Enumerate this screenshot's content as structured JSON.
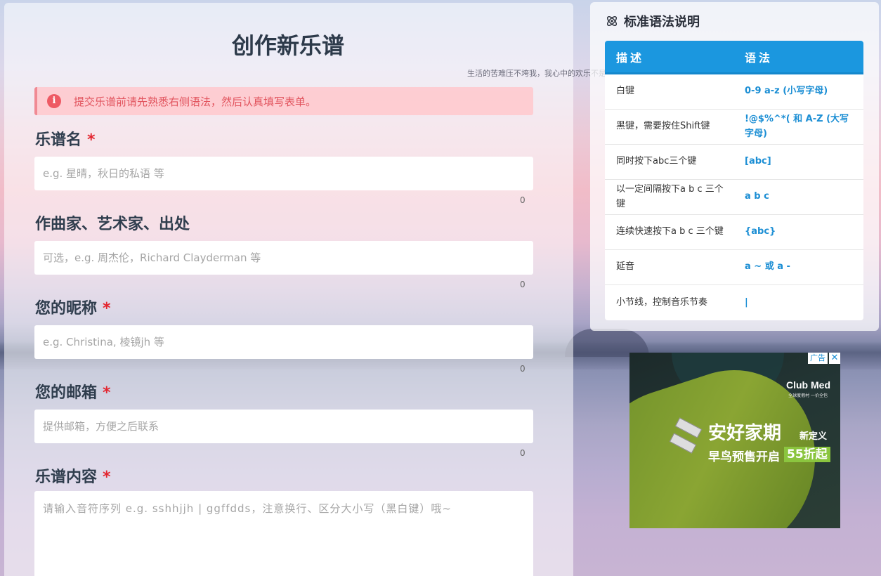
{
  "form": {
    "title": "创作新乐谱",
    "quote": "生活的苦难压不垮我，我心中的欢乐不是我个人的，我把欢乐注入音乐，为的是让全世界感到欢乐。——莫扎特",
    "alert_text": "提交乐谱前请先熟悉右侧语法，然后认真填写表单。",
    "required_mark": "*",
    "fields": [
      {
        "label": "乐谱名",
        "required": true,
        "placeholder": "e.g. 星晴，秋日的私语 等",
        "value": "",
        "count": "0"
      },
      {
        "label": "作曲家、艺术家、出处",
        "required": false,
        "placeholder": "可选，e.g. 周杰伦，Richard Clayderman 等",
        "value": "",
        "count": "0"
      },
      {
        "label": "您的昵称",
        "required": true,
        "placeholder": "e.g. Christina, 棱镜jh 等",
        "value": "",
        "count": "0"
      },
      {
        "label": "您的邮箱",
        "required": true,
        "placeholder": "提供邮箱，方便之后联系",
        "value": "",
        "count": "0"
      },
      {
        "label": "乐谱内容",
        "required": true,
        "placeholder": "请输入音符序列 e.g. sshhjjh | ggffdds，注意换行、区分大小写（黑白键）哦~",
        "value": ""
      }
    ]
  },
  "syntax": {
    "title": "标准语法说明",
    "headers": [
      "描述",
      "语法"
    ],
    "rows": [
      {
        "desc": "白键",
        "syntax": "0-9 a-z (小写字母)"
      },
      {
        "desc": "黑键，需要按住Shift键",
        "syntax": "!@$%^*( 和 A-Z (大写字母)"
      },
      {
        "desc": "同时按下abc三个键",
        "syntax": "[abc]"
      },
      {
        "desc": "以一定间隔按下a b c 三个键",
        "syntax": "a b c"
      },
      {
        "desc": "连续快速按下a b c 三个键",
        "syntax": "{abc}"
      },
      {
        "desc": "延音",
        "syntax": "a ~ 或 a -"
      },
      {
        "desc": "小节线，控制音乐节奏",
        "syntax": "|"
      }
    ]
  },
  "ad": {
    "badge": "广告",
    "close": "✕",
    "brand": "Club Med",
    "brand_sub": "全球度假村 一价全包",
    "headline": "安好家期",
    "headline_small": "新定义",
    "sub": "早鸟预售开启",
    "discount": "55折起"
  },
  "colors": {
    "accent_blue": "#1b97df",
    "alert_red": "#e2555f",
    "required_red": "#e3252f"
  }
}
